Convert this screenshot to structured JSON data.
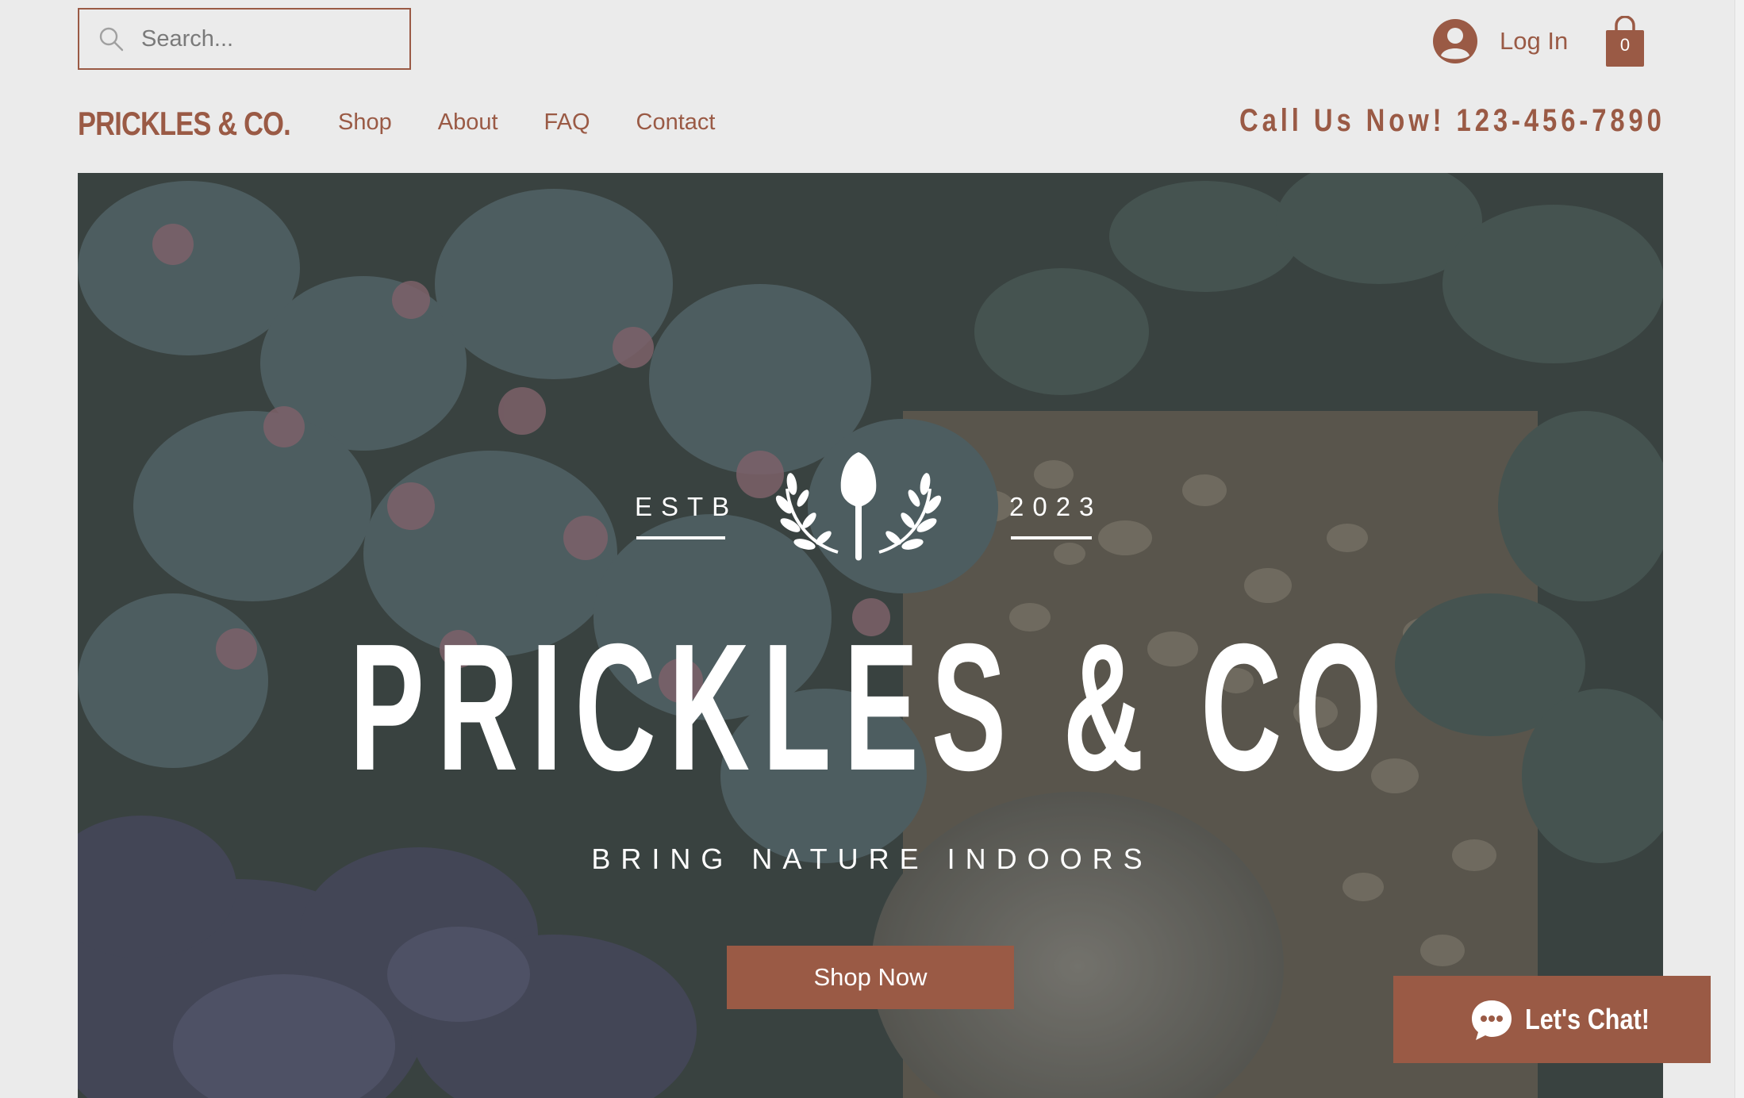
{
  "header": {
    "search_placeholder": "Search...",
    "login_label": "Log In",
    "cart_count": "0",
    "brand": "PRICKLES & CO.",
    "nav": [
      "Shop",
      "About",
      "FAQ",
      "Contact"
    ],
    "phone": "Call Us Now! 123-456-7890"
  },
  "hero": {
    "estb": "ESTB",
    "year": "2023",
    "title": "PRICKLES & CO",
    "tagline": "BRING NATURE INDOORS",
    "cta": "Shop Now"
  },
  "chat": {
    "label": "Let's Chat!"
  },
  "colors": {
    "accent": "#9a5a45",
    "page_bg": "#ebebeb"
  },
  "icons": [
    "search-icon",
    "user-avatar-icon",
    "shopping-bag-icon",
    "shovel-laurel-emblem",
    "chat-bubble-icon"
  ]
}
